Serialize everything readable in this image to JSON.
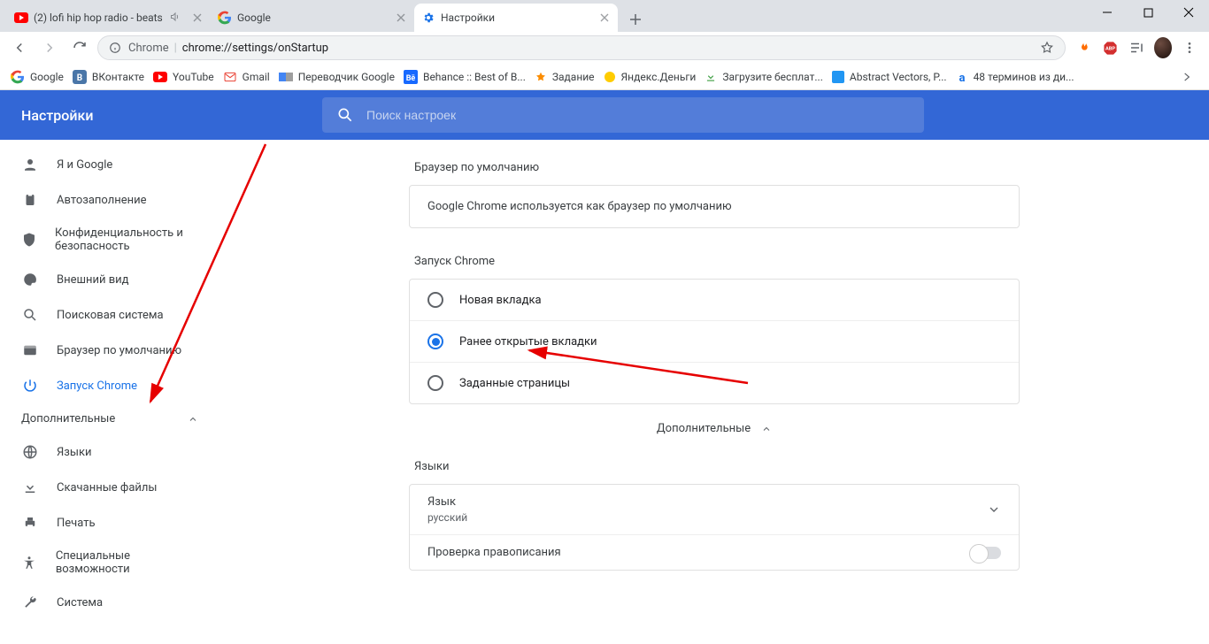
{
  "window": {
    "tabs": [
      {
        "title": "(2) lofi hip hop radio - beats",
        "has_audio": true
      },
      {
        "title": "Google"
      },
      {
        "title": "Настройки",
        "active": true
      }
    ]
  },
  "toolbar": {
    "url_label": "Chrome",
    "url_path": "chrome://settings/onStartup"
  },
  "bookmarks": [
    {
      "label": "Google"
    },
    {
      "label": "ВКонтакте"
    },
    {
      "label": "YouTube"
    },
    {
      "label": "Gmail"
    },
    {
      "label": "Переводчик Google"
    },
    {
      "label": "Behance :: Best of B..."
    },
    {
      "label": "Задание"
    },
    {
      "label": "Яндекс.Деньги"
    },
    {
      "label": "Загрузите бесплат..."
    },
    {
      "label": "Abstract Vectors, P..."
    },
    {
      "label": "48 терминов из ди..."
    }
  ],
  "settings": {
    "title": "Настройки",
    "search_placeholder": "Поиск настроек"
  },
  "sidebar": {
    "items": [
      {
        "label": "Я и Google"
      },
      {
        "label": "Автозаполнение"
      },
      {
        "label": "Конфиденциальность и безопасность"
      },
      {
        "label": "Внешний вид"
      },
      {
        "label": "Поисковая система"
      },
      {
        "label": "Браузер по умолчанию"
      },
      {
        "label": "Запуск Chrome"
      }
    ],
    "advanced_label": "Дополнительные",
    "advanced_items": [
      {
        "label": "Языки"
      },
      {
        "label": "Скачанные файлы"
      },
      {
        "label": "Печать"
      },
      {
        "label": "Специальные возможности"
      },
      {
        "label": "Система"
      }
    ]
  },
  "content": {
    "default_browser_title": "Браузер по умолчанию",
    "default_browser_text": "Google Chrome используется как браузер по умолчанию",
    "startup_title": "Запуск Chrome",
    "startup_options": [
      "Новая вкладка",
      "Ранее открытые вкладки",
      "Заданные страницы"
    ],
    "advanced_label": "Дополнительные",
    "languages_title": "Языки",
    "lang_label": "Язык",
    "lang_value": "русский",
    "spellcheck_label": "Проверка правописания"
  }
}
